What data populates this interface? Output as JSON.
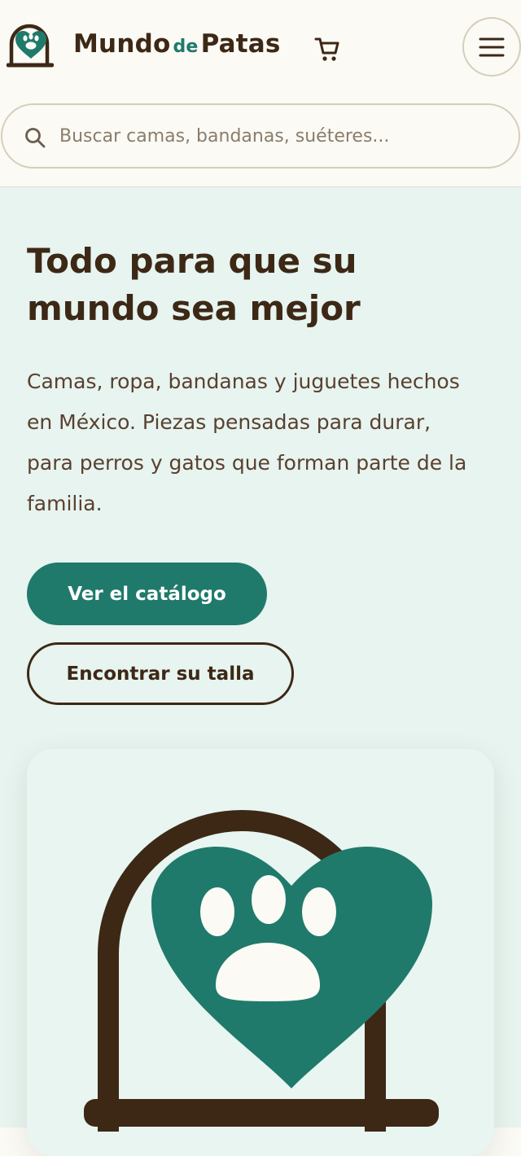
{
  "brand": {
    "name_part1": "Mundo",
    "name_de": "de",
    "name_part2": "Patas"
  },
  "header": {
    "icons": {
      "logo": "paw-heart-logo-icon",
      "cart": "shopping-cart-icon",
      "menu": "hamburger-menu-icon",
      "search": "search-icon"
    }
  },
  "search": {
    "placeholder": "Buscar camas, bandanas, suéteres..."
  },
  "hero": {
    "title": "Todo para que su mundo sea mejor",
    "description": "Camas, ropa, bandanas y juguetes hechos en México. Piezas pensadas para durar, para perros y gatos que forman parte de la familia.",
    "primary_button": "Ver el catálogo",
    "secondary_button": "Encontrar su talla",
    "illustration_icon": "paw-heart-illustration"
  },
  "colors": {
    "brand_brown": "#3d2816",
    "brand_teal": "#1f7a6b",
    "hero_background": "#e7f4ef",
    "page_background": "#fbfaf5"
  }
}
